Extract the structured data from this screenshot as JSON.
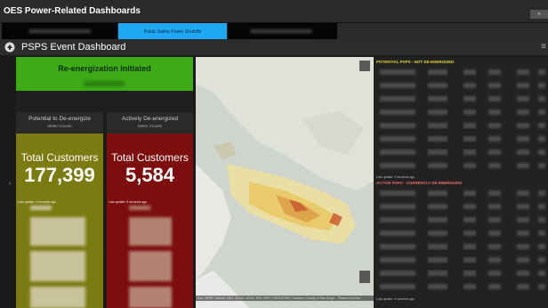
{
  "app": {
    "title": "OES Power-Related Dashboards",
    "window_control": "«"
  },
  "tabs": [
    {
      "label": "",
      "active": false
    },
    {
      "label": "Public Safety Power Shutoffs",
      "active": true
    },
    {
      "label": "",
      "active": false
    }
  ],
  "header": {
    "title": "PSPS Event Dashboard"
  },
  "status": {
    "label": "Re-energization Initiated"
  },
  "columns": [
    {
      "title": "Potential to De-energize",
      "subtitle": "Meter Counts",
      "panel_title": "Total Customers",
      "value": "177,399",
      "updated": "Last update: 9 seconds ago",
      "color": "#7c7b12"
    },
    {
      "title": "Actively De-energized",
      "subtitle": "Meter Counts",
      "panel_title": "Total Customers",
      "value": "5,584",
      "updated": "Last update: 9 seconds ago",
      "color": "#7d0e0e"
    }
  ],
  "map": {
    "attribution": "Esri, HERE, Garmin, FAO, NOAA, USGS, EPA, NPS | FGDC/ESRI | Sanborn, County of San Diego...   Powered by Esri"
  },
  "lists": [
    {
      "title": "POTENTIAL PSPS - NOT DE-ENERGIZED",
      "color": "#e8d63a",
      "updated": "Last update: 9 seconds ago"
    },
    {
      "title": "ACTIVE PSPS - CURRENTLY DE-ENERGIZED",
      "color": "#f06a6a",
      "updated": "Last update: 9 seconds ago"
    }
  ],
  "colors": {
    "green": "#3cab16",
    "olive": "#7c7b12",
    "red": "#7d0e0e",
    "tab_active": "#1ea7f2"
  }
}
